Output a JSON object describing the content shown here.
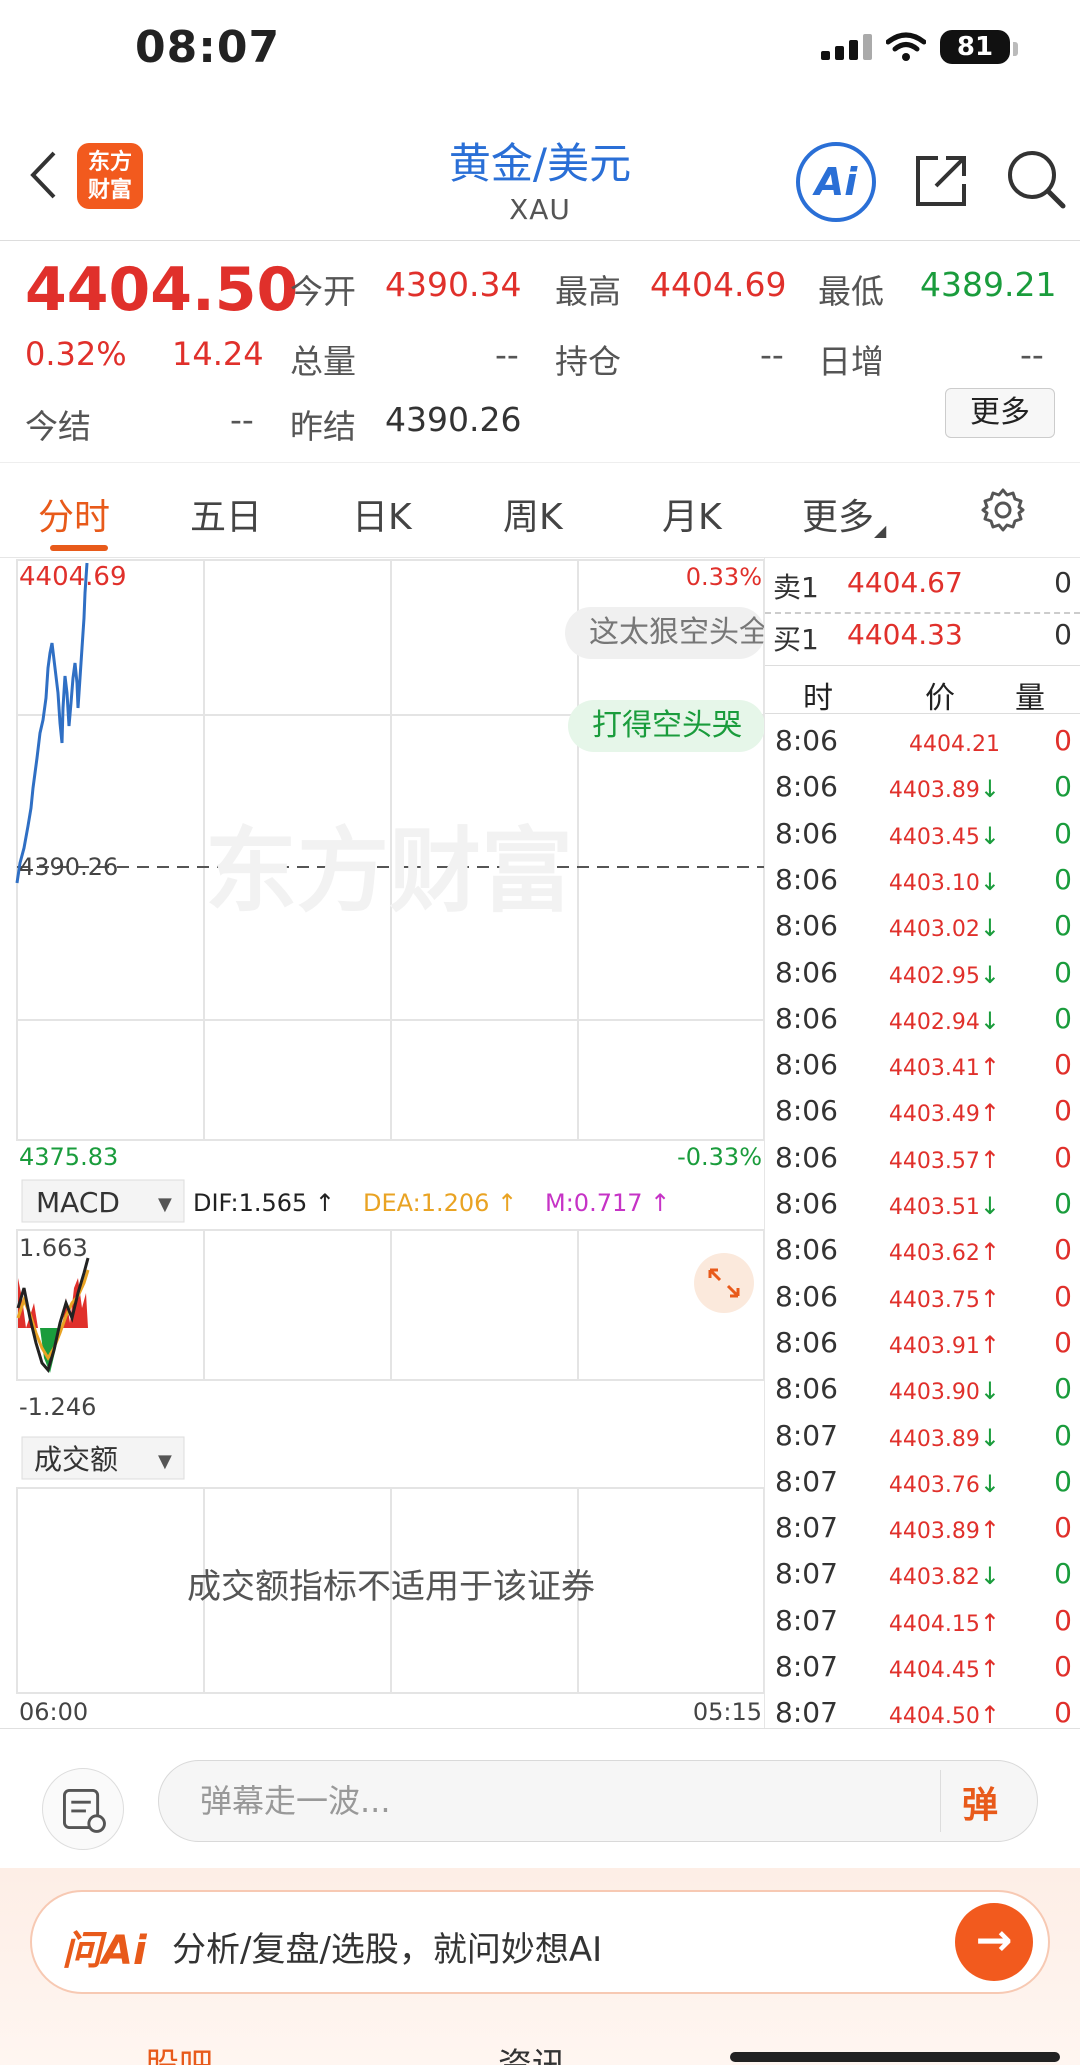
{
  "status": {
    "time": "08:07",
    "battery": "81"
  },
  "header": {
    "title": "黄金/美元",
    "subtitle": "XAU",
    "logo_line1": "东方",
    "logo_line2": "财富",
    "ai_label": "Ai"
  },
  "quote": {
    "price": "4404.50",
    "change_pct": "0.32%",
    "change": "14.24",
    "open_label": "今开",
    "open": "4390.34",
    "high_label": "最高",
    "high": "4404.69",
    "low_label": "最低",
    "low": "4389.21",
    "volume_label": "总量",
    "volume": "--",
    "position_label": "持仓",
    "position": "--",
    "daily_inc_label": "日增",
    "daily_inc": "--",
    "settle_label": "今结",
    "settle": "--",
    "prev_settle_label": "昨结",
    "prev_settle": "4390.26",
    "more_label": "更多"
  },
  "tabs": [
    "分时",
    "五日",
    "日K",
    "周K",
    "月K",
    "更多"
  ],
  "chart": {
    "max_label": "4404.69",
    "max_pct": "0.33%",
    "ref_label": "4390.26",
    "min_label": "4375.83",
    "min_pct": "-0.33%",
    "watermark": "东方财富",
    "macd_selector": "MACD",
    "dif": "DIF:1.565 ↑",
    "dea": "DEA:1.206 ↑",
    "m": "M:0.717 ↑",
    "macd_max": "1.663",
    "macd_min": "-1.246",
    "amount_selector": "成交额",
    "amount_note": "成交额指标不适用于该证券",
    "time_start": "06:00",
    "time_end": "05:15",
    "colors": {
      "line": "#2f6fc4",
      "dif": "#222222",
      "dea": "#e9a323",
      "m": "#c633c6",
      "up": "#e0302b",
      "down": "#1a9c3c"
    }
  },
  "danmu": [
    {
      "text": "这太狠空头全",
      "style": "gray"
    },
    {
      "text": "打得空头哭",
      "style": "green"
    }
  ],
  "order_book": {
    "sell_label": "卖1",
    "sell_price": "4404.67",
    "sell_vol": "0",
    "buy_label": "买1",
    "buy_price": "4404.33",
    "buy_vol": "0"
  },
  "ticks_header": {
    "time": "时",
    "price": "价",
    "vol": "量"
  },
  "ticks": [
    {
      "time": "8:06",
      "price": "4404.21",
      "dir": "",
      "vol": "0",
      "color": "red"
    },
    {
      "time": "8:06",
      "price": "4403.89",
      "dir": "↓",
      "vol": "0",
      "color": "green"
    },
    {
      "time": "8:06",
      "price": "4403.45",
      "dir": "↓",
      "vol": "0",
      "color": "green"
    },
    {
      "time": "8:06",
      "price": "4403.10",
      "dir": "↓",
      "vol": "0",
      "color": "green"
    },
    {
      "time": "8:06",
      "price": "4403.02",
      "dir": "↓",
      "vol": "0",
      "color": "green"
    },
    {
      "time": "8:06",
      "price": "4402.95",
      "dir": "↓",
      "vol": "0",
      "color": "green"
    },
    {
      "time": "8:06",
      "price": "4402.94",
      "dir": "↓",
      "vol": "0",
      "color": "green"
    },
    {
      "time": "8:06",
      "price": "4403.41",
      "dir": "↑",
      "vol": "0",
      "color": "red"
    },
    {
      "time": "8:06",
      "price": "4403.49",
      "dir": "↑",
      "vol": "0",
      "color": "red"
    },
    {
      "time": "8:06",
      "price": "4403.57",
      "dir": "↑",
      "vol": "0",
      "color": "red"
    },
    {
      "time": "8:06",
      "price": "4403.51",
      "dir": "↓",
      "vol": "0",
      "color": "green"
    },
    {
      "time": "8:06",
      "price": "4403.62",
      "dir": "↑",
      "vol": "0",
      "color": "red"
    },
    {
      "time": "8:06",
      "price": "4403.75",
      "dir": "↑",
      "vol": "0",
      "color": "red"
    },
    {
      "time": "8:06",
      "price": "4403.91",
      "dir": "↑",
      "vol": "0",
      "color": "red"
    },
    {
      "time": "8:06",
      "price": "4403.90",
      "dir": "↓",
      "vol": "0",
      "color": "green"
    },
    {
      "time": "8:07",
      "price": "4403.89",
      "dir": "↓",
      "vol": "0",
      "color": "green"
    },
    {
      "time": "8:07",
      "price": "4403.76",
      "dir": "↓",
      "vol": "0",
      "color": "green"
    },
    {
      "time": "8:07",
      "price": "4403.89",
      "dir": "↑",
      "vol": "0",
      "color": "red"
    },
    {
      "time": "8:07",
      "price": "4403.82",
      "dir": "↓",
      "vol": "0",
      "color": "green"
    },
    {
      "time": "8:07",
      "price": "4404.15",
      "dir": "↑",
      "vol": "0",
      "color": "red"
    },
    {
      "time": "8:07",
      "price": "4404.45",
      "dir": "↑",
      "vol": "0",
      "color": "red"
    },
    {
      "time": "8:07",
      "price": "4404.50",
      "dir": "↑",
      "vol": "0",
      "color": "red"
    }
  ],
  "bottom": {
    "danmu_placeholder": "弹幕走一波...",
    "danmu_send": "弹",
    "ai_logo": "问Ai",
    "ai_prompt": "分析/复盘/选股，就问妙想AI",
    "nav": [
      "股吧",
      "资讯"
    ]
  },
  "icons": [
    "back-icon",
    "share-icon",
    "search-icon",
    "settings-icon",
    "expand-icon",
    "note-icon",
    "arrow-right-icon",
    "dropdown-icon"
  ]
}
